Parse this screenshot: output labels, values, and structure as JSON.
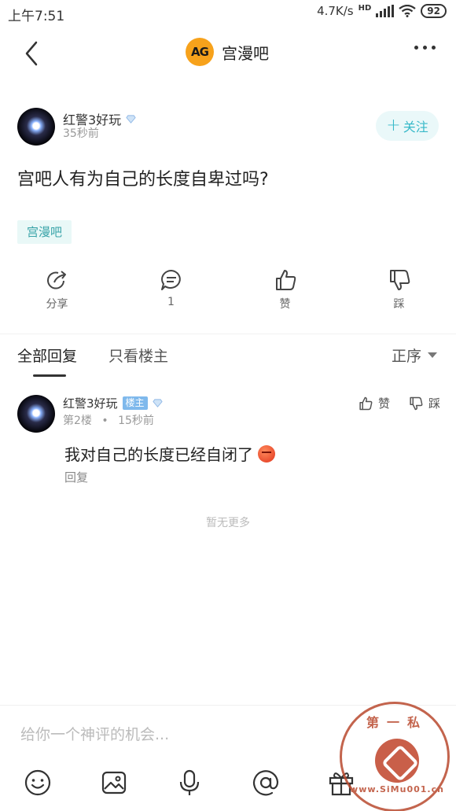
{
  "status_bar": {
    "time": "上午7:51",
    "network_speed": "4.7K/s",
    "network_type": "HD",
    "battery": "92"
  },
  "header": {
    "forum_name": "宫漫吧",
    "forum_logo_text": "AG"
  },
  "post": {
    "author": "红警3好玩",
    "time": "35秒前",
    "follow_label": "关注",
    "title": "宫吧人有为自己的长度自卑过吗?",
    "tag": "宫漫吧"
  },
  "actions": {
    "share": "分享",
    "comment_count": "1",
    "like": "赞",
    "dislike": "踩"
  },
  "tabs": {
    "all_replies": "全部回复",
    "op_only": "只看楼主",
    "sort": "正序"
  },
  "reply": {
    "author": "红警3好玩",
    "badge": "楼主",
    "floor": "第2楼",
    "separator": "•",
    "time": "15秒前",
    "like": "赞",
    "dislike": "踩",
    "text": "我对自己的长度已经自闭了",
    "reply_link": "回复"
  },
  "no_more": "暂无更多",
  "comment_input": {
    "placeholder": "给你一个神评的机会..."
  },
  "toolbar_icons": [
    "smiley-icon",
    "image-icon",
    "microphone-icon",
    "mention-icon",
    "gift-icon"
  ],
  "watermark": {
    "top_text": "第一私",
    "bottom_text": "www.SiMu001.cn"
  },
  "colors": {
    "accent": "#37b9c9",
    "tag_bg": "#e9f8f7",
    "op_badge": "#7fb9ec",
    "watermark": "#b94a2f"
  }
}
